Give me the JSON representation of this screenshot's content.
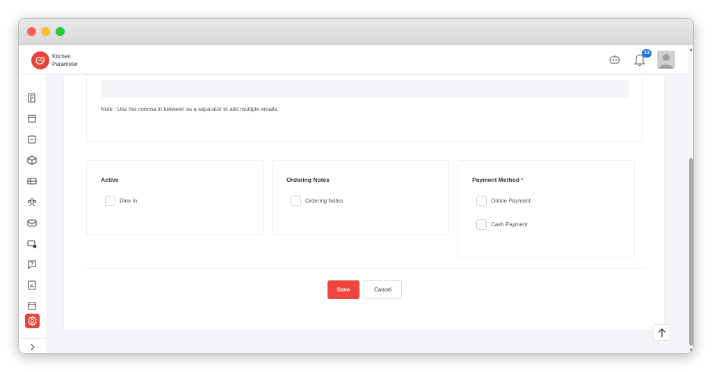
{
  "app": {
    "brand_line1": "Kitchen",
    "brand_line2": "Parameter",
    "notification_count": "13",
    "accent_color": "#e8443a"
  },
  "sidebar": {
    "items": [
      "orders-icon",
      "menu-icon",
      "calendar-icon",
      "box-icon",
      "tables-icon",
      "team-icon",
      "mail-icon",
      "payments-icon",
      "help-icon",
      "reports-icon",
      "window-icon",
      "settings-icon"
    ],
    "active": "settings-icon"
  },
  "form": {
    "email_note": "Note : Use the comma in between as a separator to add multiple emails.",
    "sections": [
      {
        "title": "Active",
        "required": false,
        "options": [
          {
            "label": "Dine In",
            "checked": false
          }
        ]
      },
      {
        "title": "Ordering Notes",
        "required": false,
        "options": [
          {
            "label": "Ordering Notes",
            "checked": false
          }
        ]
      },
      {
        "title": "Payment Method",
        "required": true,
        "required_mark": "*",
        "options": [
          {
            "label": "Online Payment",
            "checked": false
          },
          {
            "label": "Cash Payment",
            "checked": false
          }
        ]
      }
    ],
    "save_label": "Save",
    "cancel_label": "Cancel"
  }
}
